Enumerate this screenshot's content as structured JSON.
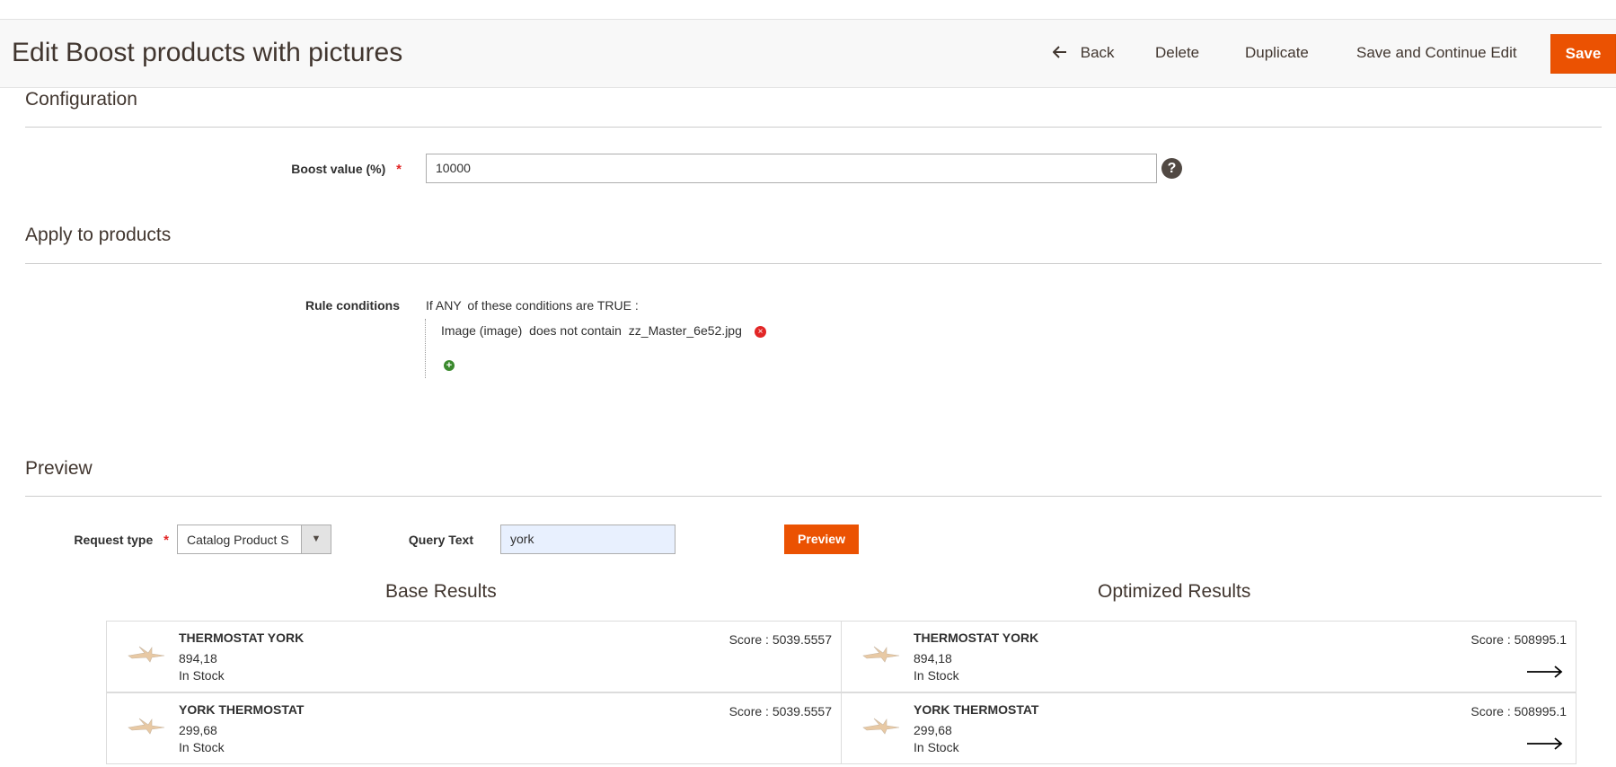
{
  "header": {
    "title": "Edit Boost products with pictures",
    "back_label": "Back",
    "delete_label": "Delete",
    "duplicate_label": "Duplicate",
    "save_continue_label": "Save and Continue Edit",
    "save_label": "Save"
  },
  "configuration": {
    "section_title": "Configuration",
    "boost_label": "Boost value (%)",
    "boost_value": "10000",
    "help_glyph": "?"
  },
  "apply": {
    "section_title": "Apply to products",
    "rule_label": "Rule conditions",
    "if_text": "If",
    "any_text": "ANY",
    "of_text": "of these conditions are",
    "true_text": "TRUE",
    "colon": ":",
    "condition": {
      "attribute": "Image (image)",
      "operator": "does not contain",
      "value": "zz_Master_6e52.jpg"
    }
  },
  "preview": {
    "section_title": "Preview",
    "request_type_label": "Request type",
    "request_type_value": "Catalog Product S",
    "query_label": "Query Text",
    "query_value": "york",
    "preview_button": "Preview",
    "base_title": "Base Results",
    "optimized_title": "Optimized Results",
    "base_results": [
      {
        "name": "THERMOSTAT YORK",
        "price": "894,18",
        "stock": "In Stock",
        "score": "Score : 5039.5557"
      },
      {
        "name": "YORK THERMOSTAT",
        "price": "299,68",
        "stock": "In Stock",
        "score": "Score : 5039.5557"
      }
    ],
    "optimized_results": [
      {
        "name": "THERMOSTAT YORK",
        "price": "894,18",
        "stock": "In Stock",
        "score": "Score : 508995.1"
      },
      {
        "name": "YORK THERMOSTAT",
        "price": "299,68",
        "stock": "In Stock",
        "score": "Score : 508995.1"
      }
    ]
  },
  "colors": {
    "accent": "#eb5202",
    "heading": "#41362f",
    "required": "#e22626"
  }
}
